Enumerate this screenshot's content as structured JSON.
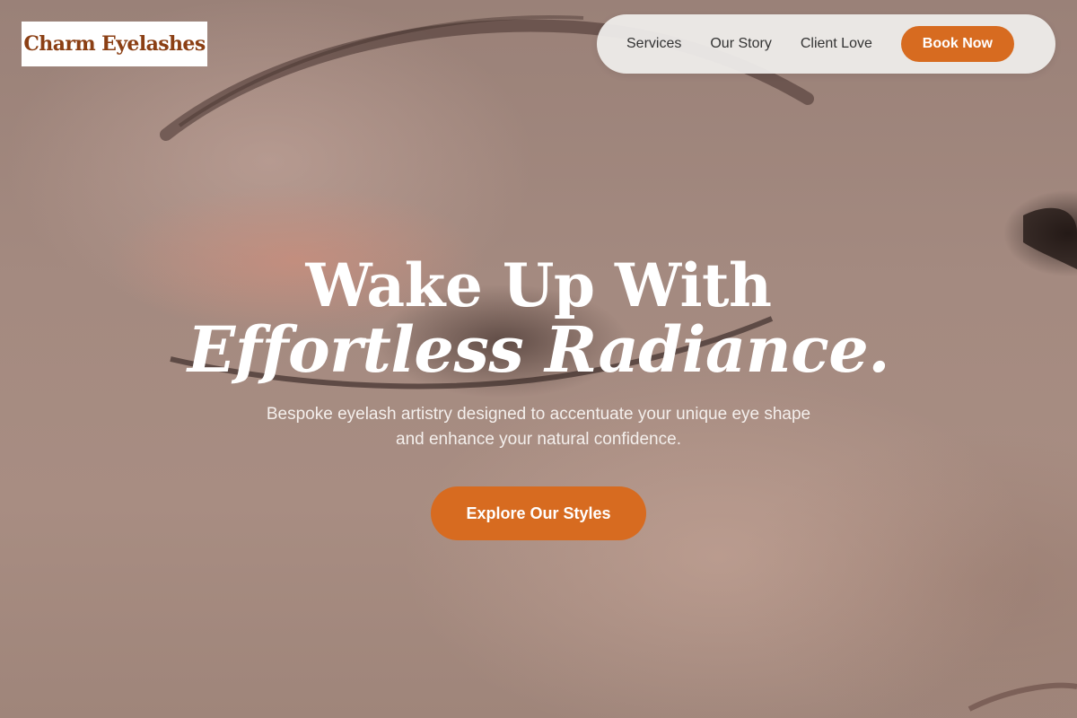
{
  "brand": {
    "name": "Charm Eyelashes"
  },
  "nav": {
    "links": [
      "Services",
      "Our Story",
      "Client Love"
    ],
    "cta_label": "Book Now"
  },
  "hero": {
    "headline_line1": "Wake Up With",
    "headline_line2": "Effortless Radiance.",
    "subtext": "Bespoke eyelash artistry designed to accentuate your unique eye shape and enhance your natural confidence.",
    "cta_label": "Explore Our Styles"
  },
  "colors": {
    "accent": "#d76b20",
    "logo_text": "#8b3f14",
    "nav_background": "#eeecea"
  }
}
